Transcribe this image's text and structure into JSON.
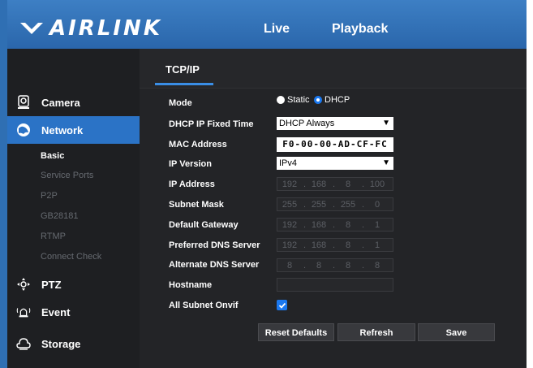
{
  "brand": {
    "logo_text": "AIRLINK"
  },
  "topnav": {
    "live": "Live",
    "playback": "Playback"
  },
  "tab": {
    "label": "TCP/IP"
  },
  "sidebar": {
    "camera": "Camera",
    "network": "Network",
    "sub": [
      "Basic",
      "Service Ports",
      "P2P",
      "GB28181",
      "RTMP",
      "Connect Check"
    ],
    "ptz": "PTZ",
    "event": "Event",
    "storage": "Storage"
  },
  "form": {
    "mode_label": "Mode",
    "mode_static": "Static",
    "mode_dhcp": "DHCP",
    "mode_selected": "DHCP",
    "dhcp_time_label": "DHCP IP Fixed Time",
    "dhcp_time_value": "DHCP Always",
    "mac_label": "MAC Address",
    "mac_value": "F0-00-00-AD-CF-FC",
    "ipver_label": "IP Version",
    "ipver_value": "IPv4",
    "ip_label": "IP Address",
    "ip": [
      "192",
      "168",
      "8",
      "100"
    ],
    "mask_label": "Subnet Mask",
    "mask": [
      "255",
      "255",
      "255",
      "0"
    ],
    "gw_label": "Default Gateway",
    "gw": [
      "192",
      "168",
      "8",
      "1"
    ],
    "dns1_label": "Preferred DNS Server",
    "dns1": [
      "192",
      "168",
      "8",
      "1"
    ],
    "dns2_label": "Alternate DNS Server",
    "dns2": [
      "8",
      "8",
      "8",
      "8"
    ],
    "hostname_label": "Hostname",
    "hostname_value": "",
    "onvif_label": "All Subnet Onvif",
    "onvif_checked": true
  },
  "buttons": {
    "reset": "Reset Defaults",
    "refresh": "Refresh",
    "save": "Save"
  },
  "colors": {
    "accent": "#2b73c6",
    "topbar": "#3d7fc4",
    "panel": "#232427",
    "check": "#1a78f0"
  }
}
